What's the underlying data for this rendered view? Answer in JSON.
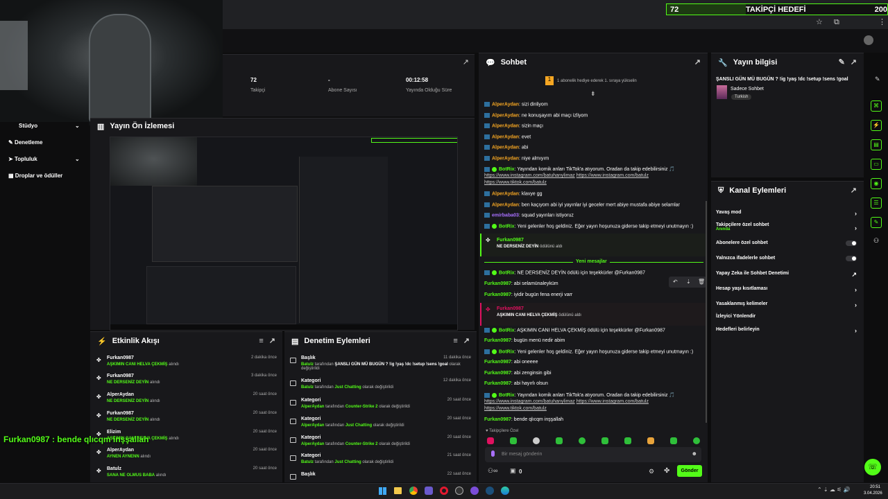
{
  "overlay": {
    "goal_count": "72",
    "goal_label": "TAKİPÇİ HEDEFİ",
    "goal_target": "200",
    "goal_progress": 0.36,
    "caption": "Furkan0987 : bende qlıcqm inşşallah"
  },
  "stats": {
    "followers_value": "72",
    "followers_label": "Takipçi",
    "subs_value": "-",
    "subs_label": "Abone Sayısı",
    "uptime_value": "00:12:58",
    "uptime_label": "Yayında Olduğu Süre"
  },
  "sidebar": {
    "items": [
      "Stüdyo",
      "Denetleme",
      "Topluluk",
      "Droplar ve ödüller"
    ]
  },
  "preview": {
    "title": "Yayın Ön İzlemesi"
  },
  "activity": {
    "title": "Etkinlik Akışı",
    "items": [
      {
        "user": "Furkan0987",
        "reward": "AŞKIMIN CANI HELVA ÇEKMİŞ",
        "suffix": "alındı",
        "time": "2 dakika önce"
      },
      {
        "user": "Furkan0987",
        "reward": "NE DERSENİZ DEYİN",
        "suffix": "alındı",
        "time": "3 dakika önce"
      },
      {
        "user": "AlperAydan",
        "reward": "NE DERSENİZ DEYİN",
        "suffix": "alındı",
        "time": "20 saat önce"
      },
      {
        "user": "Furkan0987",
        "reward": "NE DERSENİZ DEYİN",
        "suffix": "alındı",
        "time": "20 saat önce"
      },
      {
        "user": "Elizim",
        "reward": "AŞKIMIN CANI HELVA ÇEKMİŞ",
        "suffix": "alındı",
        "time": "20 saat önce"
      },
      {
        "user": "AlperAydan",
        "reward": "AYNEN AYNENN",
        "suffix": "alındı",
        "time": "20 saat önce"
      },
      {
        "user": "Batulz",
        "reward": "SANA NE OLMUS BABA",
        "suffix": "alındı",
        "time": "20 saat önce"
      }
    ]
  },
  "moderation": {
    "title": "Denetim Eylemleri",
    "items": [
      {
        "head": "Başlık",
        "user": "Batulz",
        "mid": "tarafından",
        "value": "ŞANSLI GÜN MÜ BUGÜN ? !ig !yaş !dc !setup !sens !goal",
        "end": "olarak değiştirildi",
        "time": "11 dakika önce"
      },
      {
        "head": "Kategori",
        "user": "Batulz",
        "mid": "tarafından",
        "value": "Just Chatting",
        "end": "olarak değiştirildi",
        "time": "12 dakika önce"
      },
      {
        "head": "Kategori",
        "user": "AlperAydan",
        "mid": "tarafından",
        "value": "Counter-Strike 2",
        "end": "olarak değiştirildi",
        "time": "20 saat önce"
      },
      {
        "head": "Kategori",
        "user": "AlperAydan",
        "mid": "tarafından",
        "value": "Just Chatting",
        "end": "olarak değiştirildi",
        "time": "20 saat önce"
      },
      {
        "head": "Kategori",
        "user": "AlperAydan",
        "mid": "tarafından",
        "value": "Counter-Strike 2",
        "end": "olarak değiştirildi",
        "time": "20 saat önce"
      },
      {
        "head": "Kategori",
        "user": "Batulz",
        "mid": "tarafından",
        "value": "Just Chatting",
        "end": "olarak değiştirildi",
        "time": "21 saat önce"
      },
      {
        "head": "Başlık",
        "user": "",
        "mid": "",
        "value": "",
        "end": "",
        "time": "22 saat önce"
      }
    ]
  },
  "chat": {
    "title": "Sohbet",
    "banner": "1 abonelik hediye ederek 1. sıraya yükselin",
    "new_messages": "Yeni mesajlar",
    "followers_only": "Takipçilere Özel",
    "input_placeholder": "Bir mesaj gönderin",
    "send": "Gönder",
    "count": "0",
    "lines": [
      {
        "user": "AlperAydan",
        "text": ": sizi dinliyom"
      },
      {
        "user": "AlperAydan",
        "text": ": ne konuşayım abi maçı izliyom"
      },
      {
        "user": "AlperAydan",
        "text": ": sizin maçı"
      },
      {
        "user": "AlperAydan",
        "text": ": evet"
      },
      {
        "user": "AlperAydan",
        "text": ": abi"
      },
      {
        "user": "AlperAydan",
        "text": ": niye almıyım"
      }
    ],
    "bot1": {
      "user": "BotRix",
      "text": ": Yayından komik anları TikTok'a atıyorum. Oradan da takip edebilirsiniz 🎵",
      "l1": "https://www.instagram.com/batuhanylimaz",
      "l2": "https://www.instagram.com/batulz",
      "l3": "https://www.tiktok.com/batulz"
    },
    "l7": {
      "user": "AlperAydan",
      "text": ": klavye gg"
    },
    "l8": {
      "user": "AlperAydan",
      "text": ": ben kaçıyom abi iyi yayınlar iyi geceler mert abiye mustafa abiye selamlar"
    },
    "l9": {
      "user": "emirbaba03",
      "text": ": squad yayınları istiyoruz"
    },
    "bot2": {
      "user": "BotRix",
      "text": ": Yeni gelenler hoş geldiniz. Eğer yayın hoşunuza giderse takip etmeyi unutmayın :)"
    },
    "redeem1": {
      "user": "Furkan0987",
      "reward": "NE DERSENİZ DEYİN",
      "suffix": "ödülünü aldı"
    },
    "bot3": {
      "user": "BotRix",
      "text": ": NE DERSENİZ DEYİN ödülü için teşekkürler @Furkan0987"
    },
    "l12": {
      "user": "Furkan0987",
      "text": ": abi selamünaleyküm"
    },
    "l13": {
      "user": "Furkan0987",
      "text": ": iyidir bugün fena enerji varr"
    },
    "redeem2": {
      "user": "Furkan0987",
      "reward": "AŞKIMIN CANI HELVA ÇEKMİŞ",
      "suffix": "ödülünü aldı"
    },
    "bot4": {
      "user": "BotRix",
      "text": ": AŞKIMIN CANI HELVA ÇEKMİŞ ödülü için teşekkürler @Furkan0987"
    },
    "l15": {
      "user": "Furkan0987",
      "text": ": bugün menü nedir abim"
    },
    "bot5": {
      "user": "BotRix",
      "text": ": Yeni gelenler hoş geldiniz. Eğer yayın hoşunuza giderse takip etmeyi unutmayın :)"
    },
    "l17": {
      "user": "Furkan0987",
      "text": ": abi oneeee"
    },
    "l18": {
      "user": "Furkan0987",
      "text": ": abi zenginsin gibi"
    },
    "l19": {
      "user": "Furkan0987",
      "text": ": abi hayırlı olsun"
    },
    "bot6": {
      "user": "BotRix",
      "text": ": Yayından komik anları TikTok'a atıyorum. Oradan da takip edebilirsiniz 🎵",
      "l1": "https://www.instagram.com/batuhanylimaz",
      "l2": "https://www.instagram.com/batulz",
      "l3": "https://www.tiktok.com/batulz"
    },
    "l21": {
      "user": "Furkan0987",
      "text": ": bende qlıcqm inşşallah"
    }
  },
  "stream_info": {
    "title": "Yayın bilgisi",
    "stream_title": "ŞANSLI GÜN MÜ BUGÜN ? !ig !yaş !dc !setup !sens !goal",
    "category": "Sadece Sohbet",
    "tag": "Turkish"
  },
  "channel_actions": {
    "title": "Kanal Eylemleri",
    "slow": "Yavaş mod",
    "followers": "Takipçilere özel sohbet",
    "followers_sub": "Anında",
    "subs": "Abonelere özel sohbet",
    "emotes": "Yalnızca ifadelerle sohbet",
    "ai": "Yapay Zeka ile Sohbet Denetimi",
    "age": "Hesap yaşı kısıtlaması",
    "banned": "Yasaklanmış kelimeler",
    "viewers": "İzleyici Yönlendir",
    "goals": "Hedefleri belirleyin"
  },
  "taskbar": {
    "time": "20:51",
    "date": "3.04.2026"
  },
  "colors": {
    "accent": "#53fc18",
    "bg": "#0d0d0e",
    "panel": "#18181b"
  }
}
